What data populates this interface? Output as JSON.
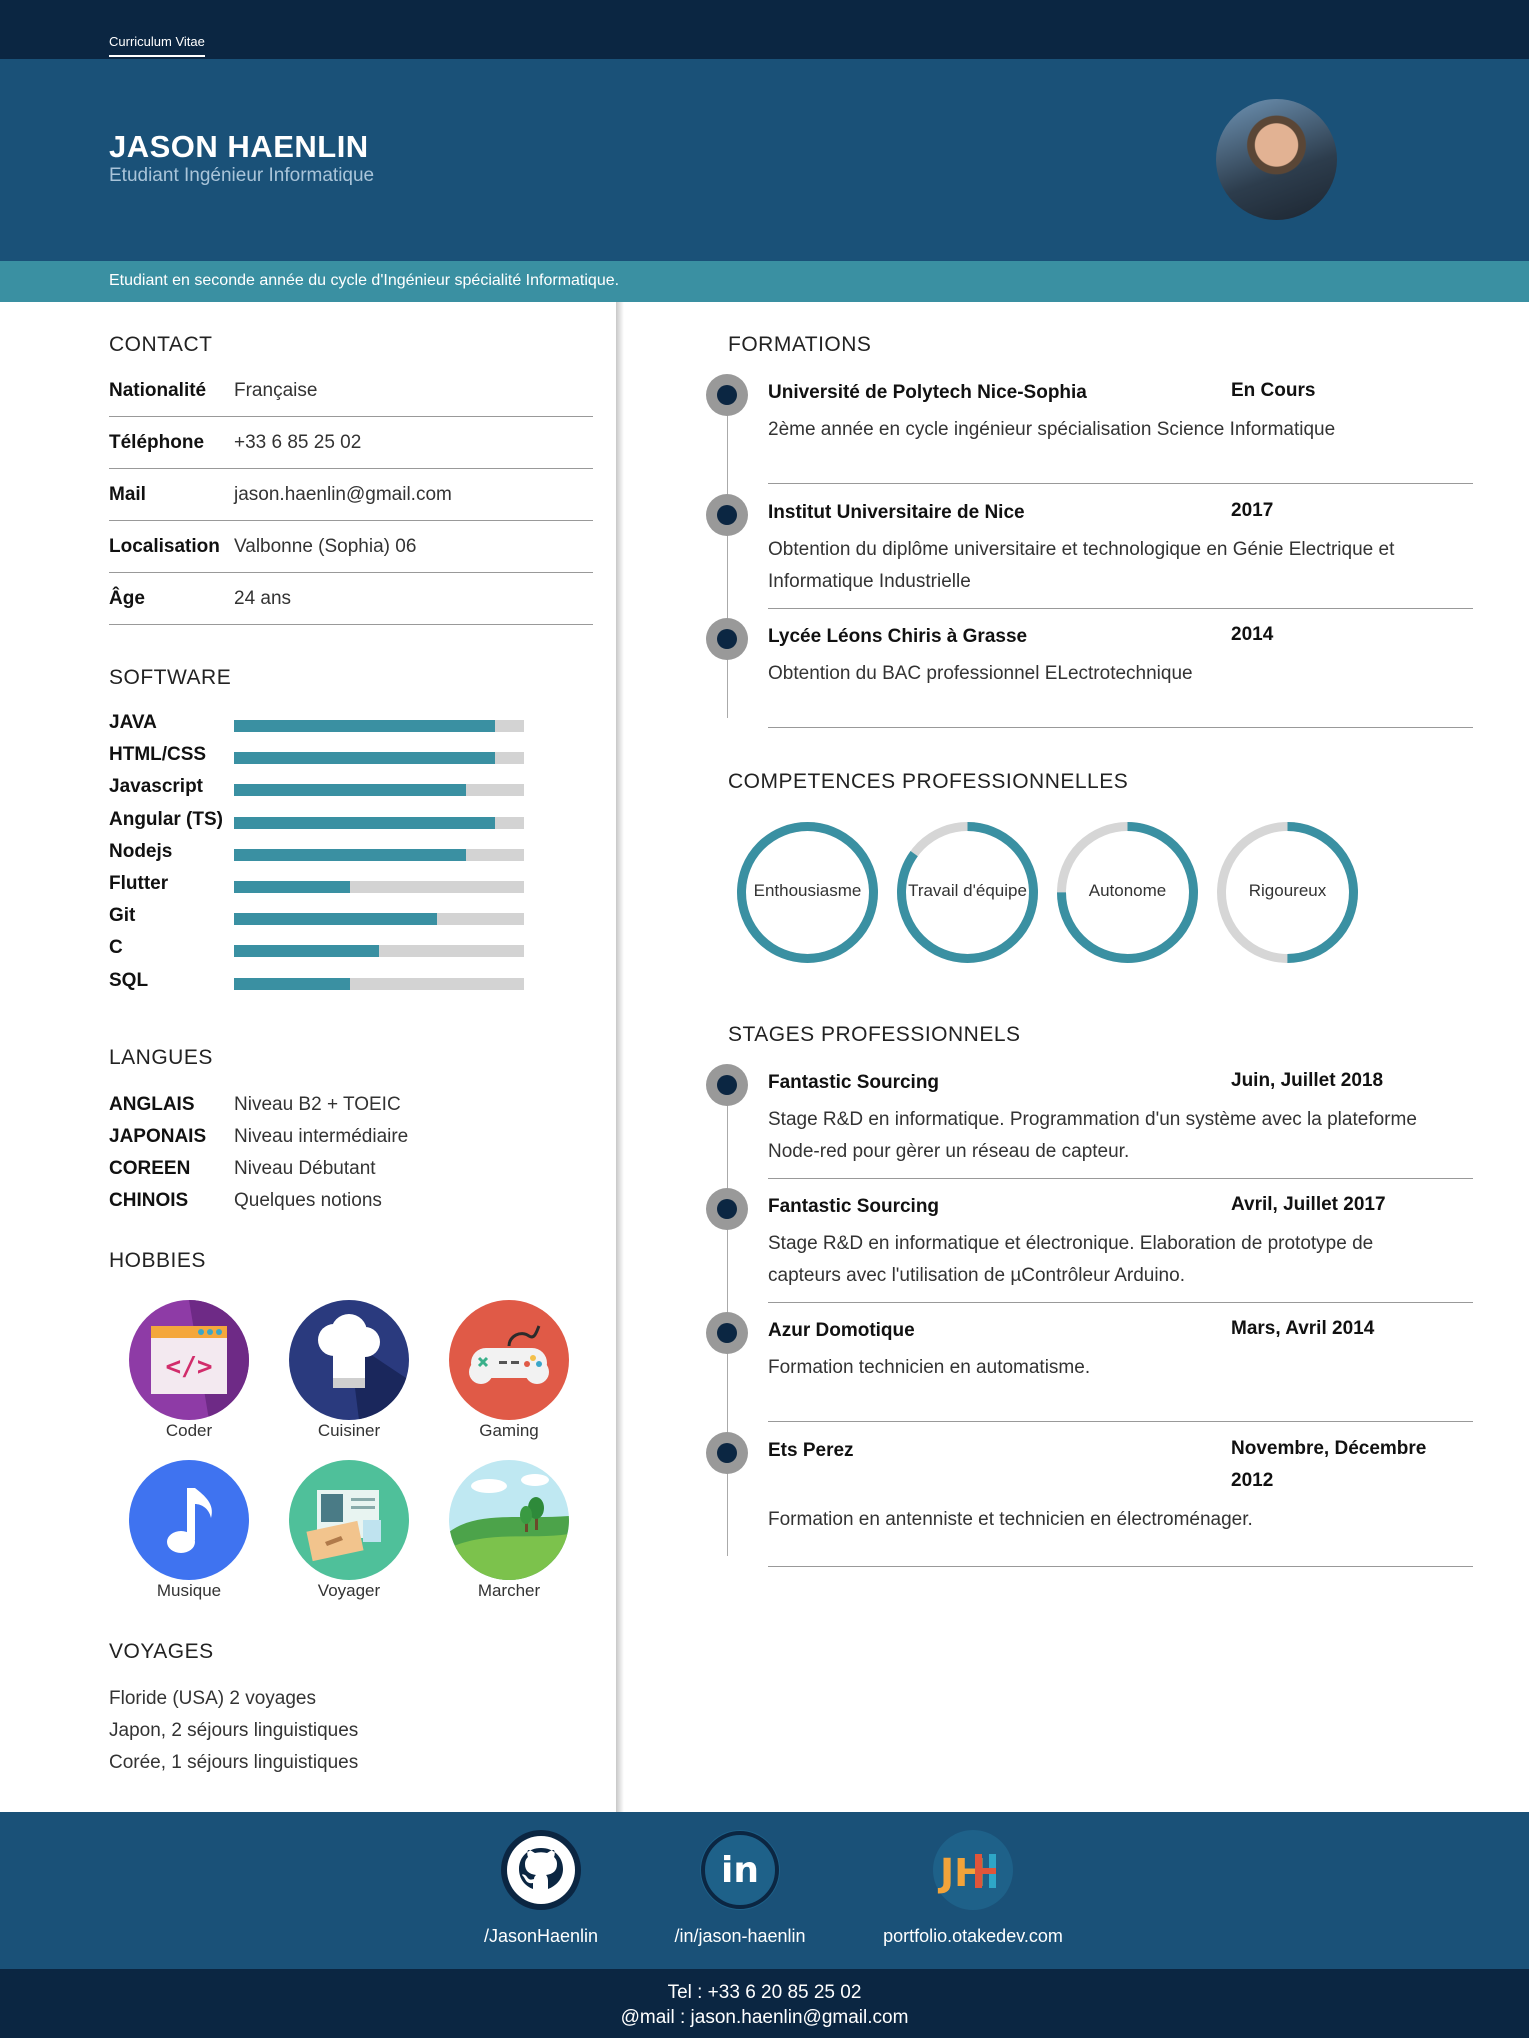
{
  "nav": {
    "tab": "Curriculum Vitae"
  },
  "header": {
    "name": "JASON HAENLIN",
    "role": "Etudiant Ingénieur Informatique",
    "summary": "Etudiant en seconde année du cycle d'Ingénieur spécialité Informatique."
  },
  "contact": {
    "title": "CONTACT",
    "rows": [
      {
        "key": "Nationalité",
        "value": "Française"
      },
      {
        "key": "Téléphone",
        "value": "+33 6 85 25 02"
      },
      {
        "key": "Mail",
        "value": "jason.haenlin@gmail.com"
      },
      {
        "key": "Localisation",
        "value": "Valbonne (Sophia) 06"
      },
      {
        "key": "Âge",
        "value": "24 ans"
      }
    ]
  },
  "software": {
    "title": "SOFTWARE",
    "items": [
      {
        "name": "JAVA",
        "level": 0.9
      },
      {
        "name": "HTML/CSS",
        "level": 0.9
      },
      {
        "name": "Javascript",
        "level": 0.8
      },
      {
        "name": "Angular (TS)",
        "level": 0.9
      },
      {
        "name": "Nodejs",
        "level": 0.8
      },
      {
        "name": "Flutter",
        "level": 0.4
      },
      {
        "name": "Git",
        "level": 0.7
      },
      {
        "name": "C",
        "level": 0.5
      },
      {
        "name": "SQL",
        "level": 0.4
      }
    ]
  },
  "langues": {
    "title": "LANGUES",
    "items": [
      {
        "name": "ANGLAIS",
        "level": "Niveau B2 + TOEIC"
      },
      {
        "name": "JAPONAIS",
        "level": "Niveau intermédiaire"
      },
      {
        "name": "COREEN",
        "level": "Niveau Débutant"
      },
      {
        "name": "CHINOIS",
        "level": "Quelques notions"
      }
    ]
  },
  "hobbies": {
    "title": "HOBBIES",
    "items": [
      {
        "label": "Coder",
        "icon": "code-icon"
      },
      {
        "label": "Cuisiner",
        "icon": "chef-hat-icon"
      },
      {
        "label": "Gaming",
        "icon": "gamepad-icon"
      },
      {
        "label": "Musique",
        "icon": "music-note-icon"
      },
      {
        "label": "Voyager",
        "icon": "passport-icon"
      },
      {
        "label": "Marcher",
        "icon": "landscape-icon"
      }
    ]
  },
  "voyages": {
    "title": "VOYAGES",
    "items": [
      "Floride (USA) 2 voyages",
      "Japon, 2 séjours linguistiques",
      "Corée, 1 séjours linguistiques"
    ]
  },
  "formations": {
    "title": "FORMATIONS",
    "items": [
      {
        "school": "Université de Polytech Nice-Sophia",
        "date": "En Cours",
        "desc": "2ème année en cycle ingénieur spécialisation Science Informatique"
      },
      {
        "school": "Institut Universitaire de Nice",
        "date": "2017",
        "desc": "Obtention du diplôme universitaire et technologique en Génie Electrique et Informatique Industrielle"
      },
      {
        "school": "Lycée Léons Chiris à Grasse",
        "date": "2014",
        "desc": "Obtention du BAC professionnel ELectrotechnique"
      }
    ]
  },
  "competences": {
    "title": "COMPETENCES PROFESSIONNELLES",
    "items": [
      {
        "label": "Enthousiasme",
        "level": 1.0
      },
      {
        "label": "Travail d'équipe",
        "level": 0.85
      },
      {
        "label": "Autonome",
        "level": 0.75
      },
      {
        "label": "Rigoureux",
        "level": 0.5
      }
    ]
  },
  "stages": {
    "title": "STAGES PROFESSIONNELS",
    "items": [
      {
        "company": "Fantastic Sourcing",
        "date": "Juin, Juillet 2018",
        "desc": "Stage R&D en informatique. Programmation d'un système avec la plateforme Node-red pour gèrer un réseau de capteur."
      },
      {
        "company": "Fantastic Sourcing",
        "date": "Avril, Juillet 2017",
        "desc": "Stage R&D en informatique et électronique. Elaboration de prototype de capteurs avec l'utilisation de µContrôleur Arduino."
      },
      {
        "company": "Azur Domotique",
        "date": "Mars, Avril 2014",
        "desc": "Formation technicien en automatisme."
      },
      {
        "company": "Ets Perez",
        "date": "Novembre, Décembre 2012",
        "desc": "Formation en antenniste et technicien en électroménager."
      }
    ]
  },
  "footer": {
    "links": [
      {
        "label": "/JasonHaenlin",
        "icon": "github-icon"
      },
      {
        "label": "/in/jason-haenlin",
        "icon": "linkedin-icon"
      },
      {
        "label": "portfolio.otakedev.com",
        "icon": "jh-logo-icon",
        "logo_text": "JH"
      }
    ],
    "tel": "Tel : +33 6 20 85 25 02",
    "mail": "@mail : jason.haenlin@gmail.com"
  },
  "colors": {
    "navy": "#0b2642",
    "blue": "#1a5178",
    "teal": "#3a90a2"
  }
}
